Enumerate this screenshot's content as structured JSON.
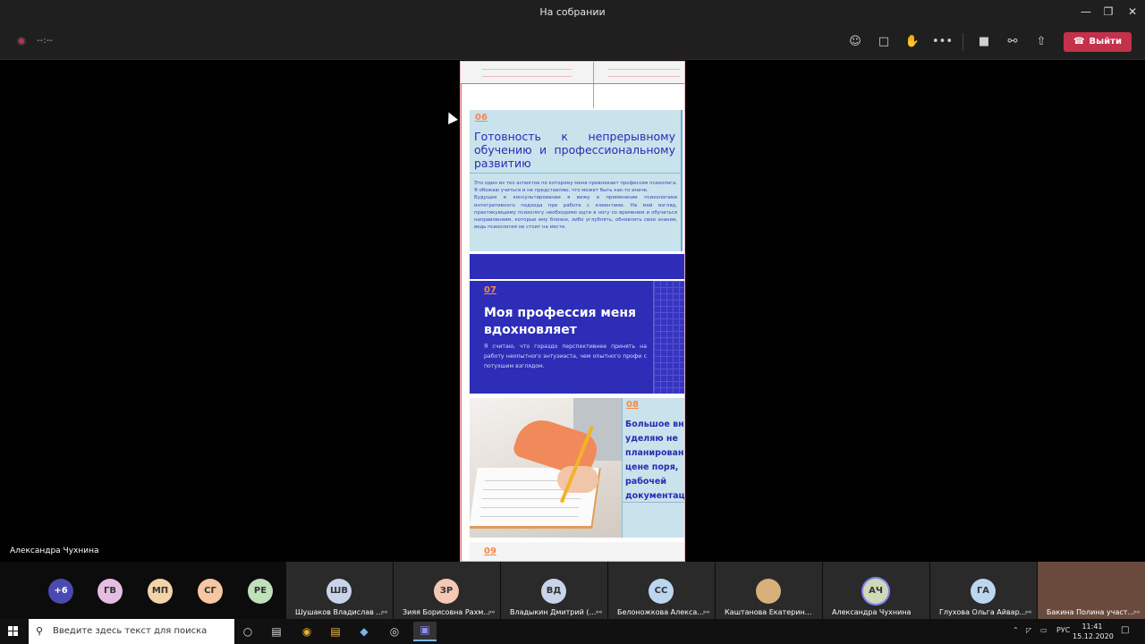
{
  "window": {
    "title": "На собрании"
  },
  "toolbar": {
    "timer": "--:--",
    "leave_label": "Выйти",
    "colors": {
      "leave": "#c4314b"
    }
  },
  "stage": {
    "presenter_name": "Александра Чухнина"
  },
  "document": {
    "sec06": {
      "number": "06",
      "heading": "Готовность к непрерывному обучению и профессиональному развитию",
      "body": "Это один из тех аспектов по которому меня привлекает профессия психолога. Я обожаю учиться и не представляю, что может быть как-то иначе.\nБудущее в консультировании я вижу в применении психологами интегративного подхода при работе с клиентами. На мой взгляд, практикующему психологу необходимо идти в ногу со временем и обучаться направлениям, которые ему близки, либо углублять, обновлять свои знания, ведь психология не стоит на месте."
    },
    "sec07": {
      "number": "07",
      "heading": "Моя профессия меня вдохновляет",
      "body": "Я считаю, что гораздо перспективнее принять на работу неопытного энтузиаста, чем опытного профи с потухшим взглядом."
    },
    "sec08": {
      "number": "08",
      "lines": [
        "Большое вни",
        "уделяю    не",
        "планировани",
        "цене  поря,",
        "рабочей",
        "документаци"
      ]
    },
    "sec09": {
      "number": "09"
    },
    "colors": {
      "accent": "#f28a48",
      "navy": "#2d2db8",
      "light": "#c9e3ec"
    }
  },
  "participants": {
    "overflow": {
      "label": "+6",
      "color": "#4a4ab0"
    },
    "initials": [
      {
        "initials": "ГВ",
        "color": "#e6bde0"
      },
      {
        "initials": "МП",
        "color": "#f3d3a8"
      },
      {
        "initials": "СГ",
        "color": "#f6c7a2"
      },
      {
        "initials": "РЕ",
        "color": "#bfe0b8"
      }
    ],
    "tiles": [
      {
        "initials": "ШВ",
        "name": "Шушаков Владислав ...",
        "color": "#c9d3ea"
      },
      {
        "initials": "ЗР",
        "name": "Зияя Борисовна Рахм...",
        "color": "#f6c7b5"
      },
      {
        "initials": "ВД",
        "name": "Владыкин Дмитрий (г...",
        "color": "#c9d3ea"
      },
      {
        "initials": "СС",
        "name": "Белоножкова Алексан...",
        "color": "#bcd6f0"
      },
      {
        "initials": "",
        "name": "Каштанова Екатерина Ви...",
        "color": "#d7b07a"
      },
      {
        "initials": "АЧ",
        "name": "Александра Чухнина",
        "color": "#cfd9b6"
      },
      {
        "initials": "ГА",
        "name": "Глухова Ольга Айвар...",
        "color": "#bcd6f0"
      },
      {
        "initials": "",
        "name": "Бакина Полина участ...",
        "color": "#8a5a4a"
      }
    ]
  },
  "taskbar": {
    "search_placeholder": "Введите здесь текст для поиска",
    "language": "РУС",
    "time": "11:41",
    "date": "15.12.2020"
  }
}
